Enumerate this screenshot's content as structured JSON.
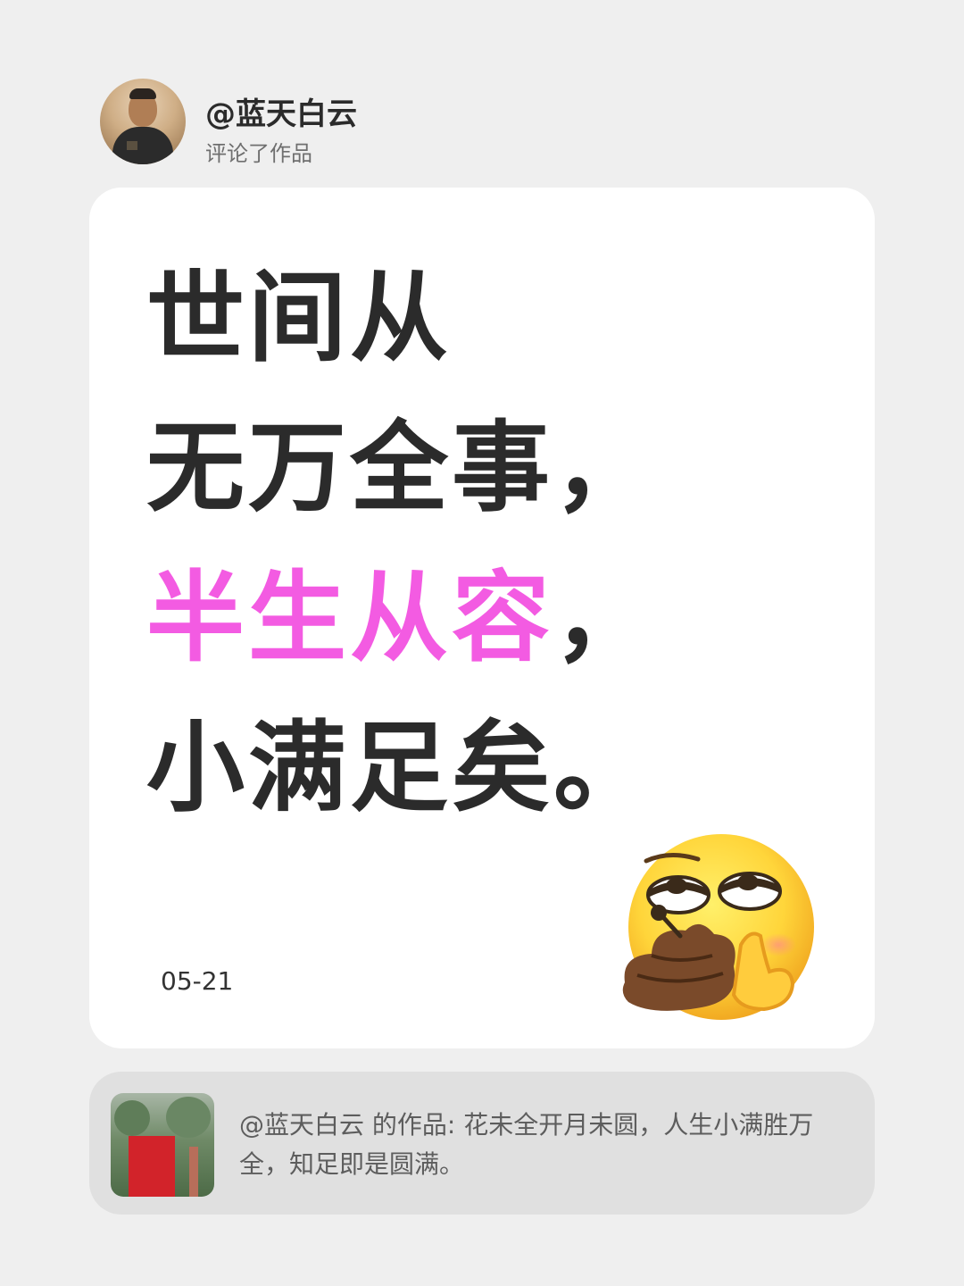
{
  "header": {
    "handle": "@蓝天白云",
    "action": "评论了作品",
    "avatar_icon": "person-avatar"
  },
  "card": {
    "lines": [
      "世间从",
      "无万全事，",
      "半生从容",
      "，",
      "小满足矣。"
    ],
    "highlight_color": "#f35be2",
    "date": "05-21",
    "emoji_icon": "eye-roll-thinking-emoji"
  },
  "reference": {
    "text": "@蓝天白云 的作品: 花未全开月未圆，人生小满胜万全，知足即是圆满。",
    "thumbnail_icon": "post-thumbnail"
  }
}
